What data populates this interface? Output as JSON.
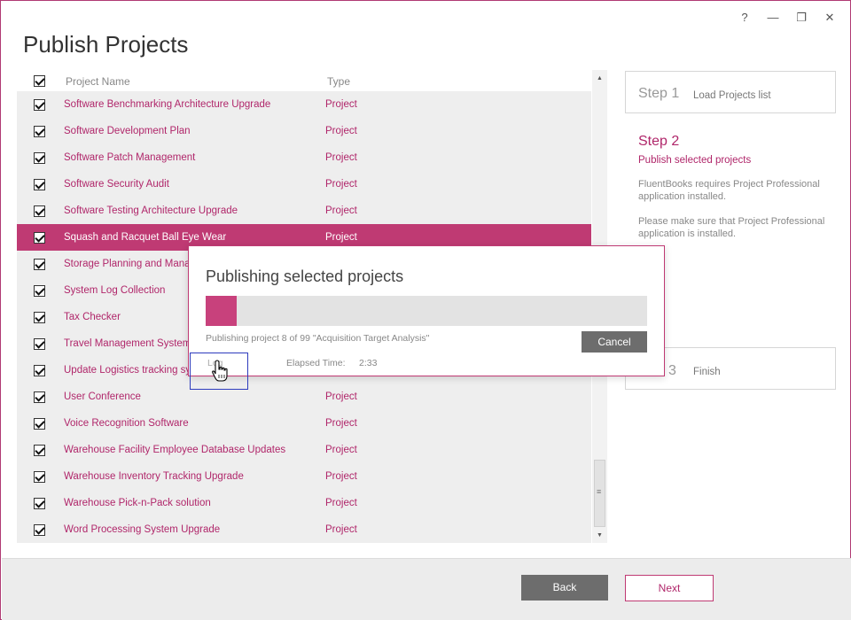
{
  "window": {
    "title": "Publish Projects",
    "controls": {
      "help": "?",
      "minimize": "—",
      "restore": "❐",
      "close": "✕"
    }
  },
  "list": {
    "header": {
      "name": "Project Name",
      "type": "Type"
    },
    "rows": [
      {
        "name": "Software Benchmarking Architecture Upgrade",
        "type": "Project",
        "checked": true,
        "selected": false
      },
      {
        "name": "Software Development Plan",
        "type": "Project",
        "checked": true,
        "selected": false
      },
      {
        "name": "Software Patch Management",
        "type": "Project",
        "checked": true,
        "selected": false
      },
      {
        "name": "Software Security Audit",
        "type": "Project",
        "checked": true,
        "selected": false
      },
      {
        "name": "Software Testing Architecture Upgrade",
        "type": "Project",
        "checked": true,
        "selected": false
      },
      {
        "name": "Squash and Racquet Ball Eye Wear",
        "type": "Project",
        "checked": true,
        "selected": true
      },
      {
        "name": "Storage Planning and Mana",
        "type": "",
        "checked": true,
        "selected": false
      },
      {
        "name": "System Log Collection",
        "type": "",
        "checked": true,
        "selected": false
      },
      {
        "name": "Tax Checker",
        "type": "",
        "checked": true,
        "selected": false
      },
      {
        "name": "Travel Management System",
        "type": "",
        "checked": true,
        "selected": false
      },
      {
        "name": "Update Logistics tracking sy",
        "type": "",
        "checked": true,
        "selected": false
      },
      {
        "name": "User Conference",
        "type": "Project",
        "checked": true,
        "selected": false
      },
      {
        "name": "Voice Recognition Software",
        "type": "Project",
        "checked": true,
        "selected": false
      },
      {
        "name": "Warehouse Facility Employee Database Updates",
        "type": "Project",
        "checked": true,
        "selected": false
      },
      {
        "name": "Warehouse Inventory Tracking Upgrade",
        "type": "Project",
        "checked": true,
        "selected": false
      },
      {
        "name": "Warehouse Pick-n-Pack solution",
        "type": "Project",
        "checked": true,
        "selected": false
      },
      {
        "name": "Word Processing System Upgrade",
        "type": "Project",
        "checked": true,
        "selected": false
      }
    ]
  },
  "steps": {
    "step1": {
      "num": "Step 1",
      "text": "Load Projects list"
    },
    "step2": {
      "num": "Step 2",
      "text": "Publish selected projects",
      "note1": "FluentBooks requires Project Professional application installed.",
      "note2": "Please make sure that Project Professional application is installed."
    },
    "step3": {
      "num": "3",
      "text": "Finish"
    }
  },
  "dialog": {
    "title": "Publishing selected projects",
    "progress_fraction": 0.07,
    "status": "Publishing project 8 of 99 \"Acquisition Target Analysis\"",
    "cancel_label": "Cancel",
    "log_label": "Log",
    "elapsed_label": "Elapsed Time:",
    "elapsed_value": "2:33"
  },
  "footer": {
    "back_label": "Back",
    "next_label": "Next"
  },
  "colors": {
    "accent": "#bf3a73",
    "accent_text": "#b0266a",
    "button_gray": "#6d6d6d",
    "focus": "#2d3bbd"
  }
}
